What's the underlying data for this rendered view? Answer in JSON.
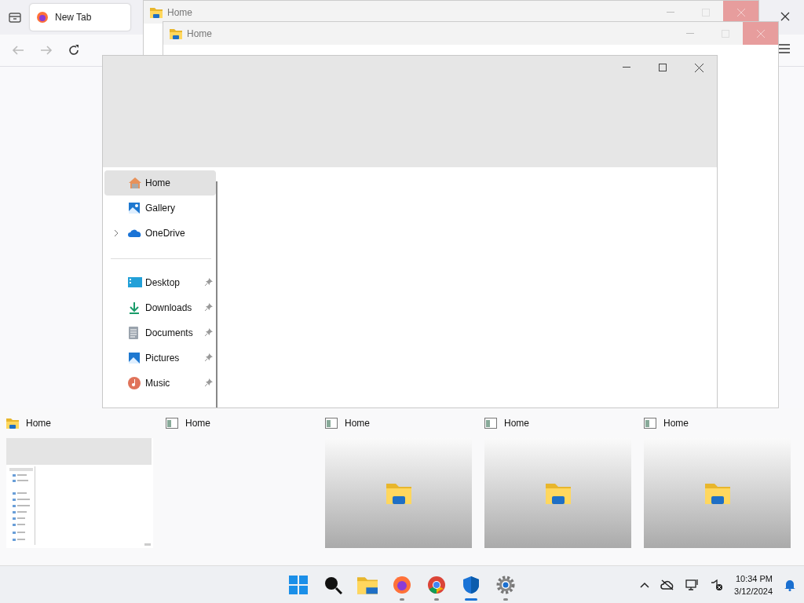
{
  "browser": {
    "tabs": [
      {
        "title": "New Tab",
        "selected": true
      }
    ]
  },
  "windows": [
    {
      "title": "Home"
    },
    {
      "title": "Home"
    }
  ],
  "explorer": {
    "sidebar": {
      "items": [
        {
          "label": "Home",
          "kind": "home",
          "selected": true,
          "expandable": false,
          "pinned": false
        },
        {
          "label": "Gallery",
          "kind": "gallery",
          "selected": false,
          "expandable": false,
          "pinned": false
        },
        {
          "label": "OneDrive",
          "kind": "cloud",
          "selected": false,
          "expandable": true,
          "pinned": false
        },
        {
          "kind": "divider"
        },
        {
          "label": "Desktop",
          "kind": "desktop",
          "selected": false,
          "expandable": false,
          "pinned": true
        },
        {
          "label": "Downloads",
          "kind": "downloads",
          "selected": false,
          "expandable": false,
          "pinned": true
        },
        {
          "label": "Documents",
          "kind": "documents",
          "selected": false,
          "expandable": false,
          "pinned": true
        },
        {
          "label": "Pictures",
          "kind": "pictures",
          "selected": false,
          "expandable": false,
          "pinned": true
        },
        {
          "label": "Music",
          "kind": "music",
          "selected": false,
          "expandable": false,
          "pinned": true
        }
      ]
    }
  },
  "task_switcher": {
    "items": [
      {
        "title": "Home",
        "kind": "explorer-preview"
      },
      {
        "title": "Home",
        "kind": "blank"
      },
      {
        "title": "Home",
        "kind": "folder-preview"
      },
      {
        "title": "Home",
        "kind": "folder-preview"
      },
      {
        "title": "Home",
        "kind": "folder-preview"
      }
    ]
  },
  "taskbar": {
    "apps": [
      {
        "kind": "start",
        "running": false,
        "active": false
      },
      {
        "kind": "search",
        "running": false,
        "active": false
      },
      {
        "kind": "explorer",
        "running": false,
        "active": false
      },
      {
        "kind": "firefox",
        "running": true,
        "active": false
      },
      {
        "kind": "chrome",
        "running": true,
        "active": false
      },
      {
        "kind": "defender",
        "running": true,
        "active": true
      },
      {
        "kind": "settings",
        "running": true,
        "active": false
      }
    ],
    "clock": {
      "time": "10:34 PM",
      "date": "3/12/2024"
    }
  }
}
